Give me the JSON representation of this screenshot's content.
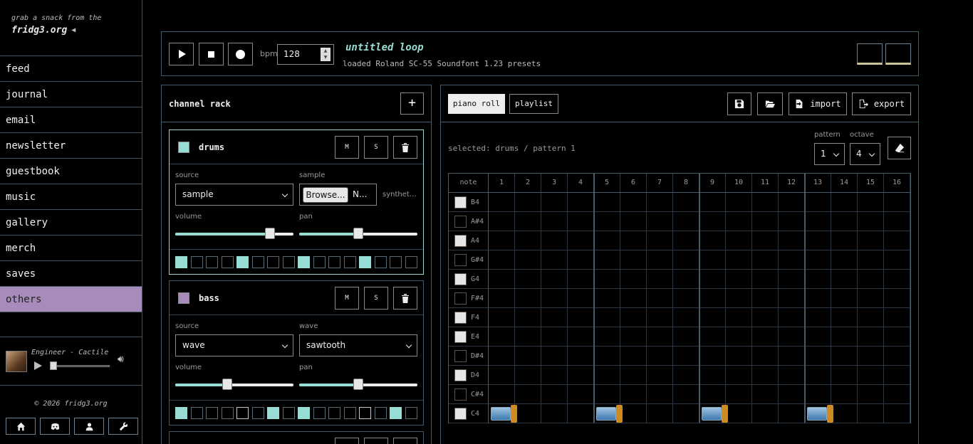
{
  "sidebar": {
    "brand_sub": "grab a snack from the",
    "brand_main": "fridg3.org",
    "nav": [
      "feed",
      "journal",
      "email",
      "newsletter",
      "guestbook",
      "music",
      "gallery",
      "merch",
      "saves",
      "others"
    ],
    "active_index": 9,
    "player": {
      "track": "Engineer - Cactile"
    },
    "copyright": "© 2026 fridg3.org",
    "socials": [
      "home-icon",
      "discord-icon",
      "user-icon",
      "wrench-icon"
    ]
  },
  "transport": {
    "bpm_label": "bpm",
    "bpm_value": "128",
    "loop_title": "untitled loop",
    "status": "loaded Roland SC-55 Soundfont 1.23 presets"
  },
  "rack": {
    "title": "channel rack",
    "add_label": "+",
    "channels": [
      {
        "name": "drums",
        "color": "#97ddd5",
        "mute": "M",
        "solo": "S",
        "source_label": "source",
        "source_value": "sample",
        "second_label": "sample",
        "browse_label": "Browse...",
        "file_value": "N...",
        "synth_text": "synthet…",
        "volume_label": "volume",
        "pan_label": "pan",
        "volume": 0.8,
        "pan": 0.5,
        "steps": [
          1,
          0,
          0,
          0,
          1,
          0,
          0,
          0,
          1,
          0,
          0,
          0,
          1,
          0,
          0,
          0
        ]
      },
      {
        "name": "bass",
        "color": "#a78bba",
        "mute": "M",
        "solo": "S",
        "source_label": "source",
        "source_value": "wave",
        "second_label": "wave",
        "wave_value": "sawtooth",
        "volume_label": "volume",
        "pan_label": "pan",
        "volume": 0.44,
        "pan": 0.5,
        "steps": [
          1,
          0,
          0,
          0,
          0,
          0,
          1,
          0,
          1,
          0,
          0,
          0,
          0,
          0,
          1,
          0
        ]
      }
    ]
  },
  "editor": {
    "tabs": [
      "piano roll",
      "playlist"
    ],
    "active_tab": 0,
    "import_label": "import",
    "export_label": "export",
    "selected_text": "selected: drums / pattern 1",
    "pattern_label": "pattern",
    "pattern_value": "1",
    "octave_label": "octave",
    "octave_value": "4",
    "note_header": "note",
    "columns": [
      "1",
      "2",
      "3",
      "4",
      "5",
      "6",
      "7",
      "8",
      "9",
      "10",
      "11",
      "12",
      "13",
      "14",
      "15",
      "16"
    ],
    "notes": [
      "B4",
      "A#4",
      "A4",
      "G#4",
      "G4",
      "F#4",
      "F4",
      "E4",
      "D#4",
      "D4",
      "C#4",
      "C4"
    ],
    "note_events": [
      {
        "note": "C4",
        "step": 1
      },
      {
        "note": "C4",
        "step": 5
      },
      {
        "note": "C4",
        "step": 9
      },
      {
        "note": "C4",
        "step": 13
      }
    ]
  }
}
